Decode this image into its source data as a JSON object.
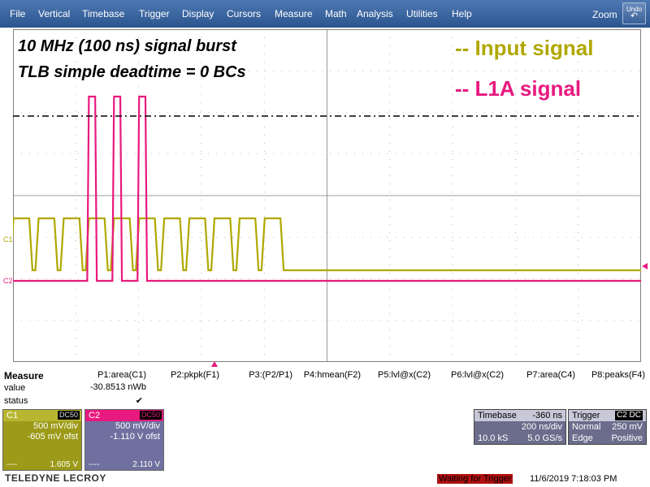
{
  "menu": [
    "File",
    "Vertical",
    "Timebase",
    "Trigger",
    "Display",
    "Cursors",
    "Measure",
    "Math",
    "Analysis",
    "Utilities",
    "Help"
  ],
  "zoom_label": "Zoom",
  "undo_label": "Undo",
  "annotations": {
    "line1": "10 MHz (100 ns) signal burst",
    "line2": "TLB simple deadtime = 0 BCs",
    "legend_input": "-- Input signal",
    "legend_l1a": "-- L1A signal"
  },
  "markers": {
    "c1": "C1",
    "c2": "C2"
  },
  "colors": {
    "input": "#b0a800",
    "l1a": "#e8197f",
    "grid": "#808080",
    "menu": "#3a6098"
  },
  "measure": {
    "title": "Measure",
    "row_value": "value",
    "row_status": "status",
    "columns": [
      {
        "label": "P1:area(C1)",
        "value": "-30.8513 nWb",
        "status": "✔"
      },
      {
        "label": "P2:pkpk(F1)",
        "value": "",
        "status": ""
      },
      {
        "label": "P3:(P2/P1)",
        "value": "",
        "status": ""
      },
      {
        "label": "P4:hmean(F2)",
        "value": "",
        "status": ""
      },
      {
        "label": "P5:lvl@x(C2)",
        "value": "",
        "status": ""
      },
      {
        "label": "P6:lvl@x(C2)",
        "value": "",
        "status": ""
      },
      {
        "label": "P7:area(C4)",
        "value": "",
        "status": ""
      },
      {
        "label": "P8:peaks(F4)",
        "value": "",
        "status": ""
      }
    ]
  },
  "channels": {
    "c1": {
      "name": "C1",
      "coupling": "DC50",
      "vdiv": "500 mV/div",
      "offset": "-605 mV ofst",
      "foot_left": "----",
      "foot_right": "1.605 V"
    },
    "c2": {
      "name": "C2",
      "coupling": "DC50",
      "vdiv": "500 mV/div",
      "offset": "-1.110 V ofst",
      "foot_left": "----",
      "foot_right": "2.110 V"
    }
  },
  "timebase": {
    "label": "Timebase",
    "delay": "-360 ns",
    "tdiv": "200 ns/div",
    "samples": "10.0 kS",
    "rate": "5.0 GS/s"
  },
  "trigger": {
    "label": "Trigger",
    "source": "C2",
    "coupling": "DC",
    "mode": "Normal",
    "level": "250 mV",
    "type": "Edge",
    "slope": "Positive"
  },
  "brand": "TELEDYNE LECROY",
  "status": {
    "state": "Waiting for Trigger",
    "datetime": "11/6/2019 7:18:03 PM"
  },
  "signal": {
    "input_pulse_starts_ns": [
      -640,
      -560,
      -480,
      -400,
      -320,
      -240,
      -160,
      -80,
      0,
      80,
      160
    ],
    "pulse_width_ns": 50,
    "l1a_pulse_starts_ns": [
      -400,
      -320,
      -240
    ],
    "l1a_width_ns": 20
  }
}
